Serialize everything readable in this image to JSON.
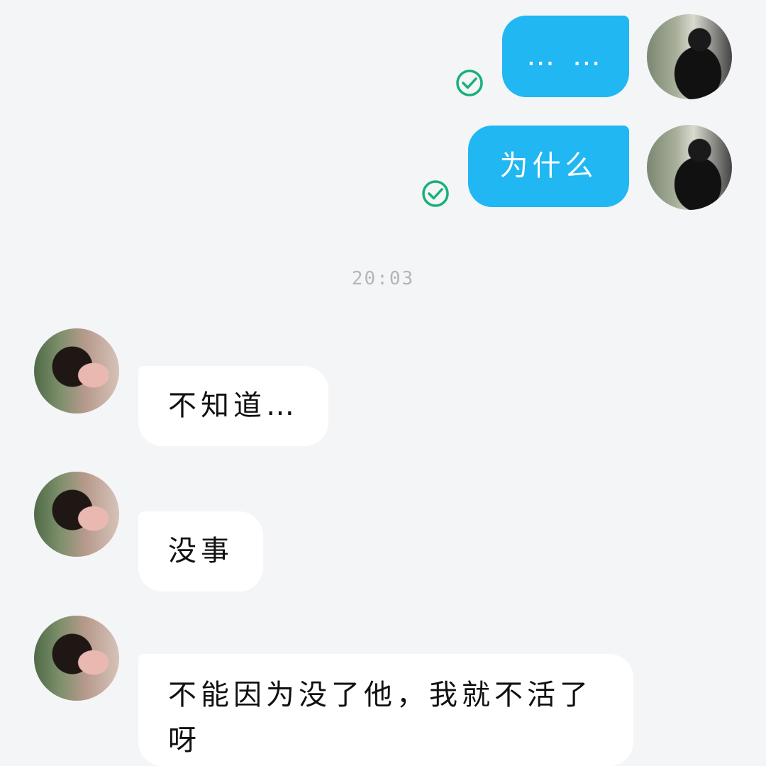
{
  "conversation": {
    "sent": [
      {
        "text": "… …",
        "status_icon": "check-circle-icon"
      },
      {
        "text": "为什么",
        "status_icon": "check-circle-icon"
      }
    ],
    "timestamp": "20:03",
    "received": [
      {
        "text": "不知道…"
      },
      {
        "text": "没事"
      },
      {
        "text": "不能因为没了他，我就不活了呀"
      }
    ]
  },
  "colors": {
    "sent_bubble": "#20b7f2",
    "received_bubble": "#ffffff",
    "check": "#18b07a",
    "background": "#f4f5f6"
  }
}
